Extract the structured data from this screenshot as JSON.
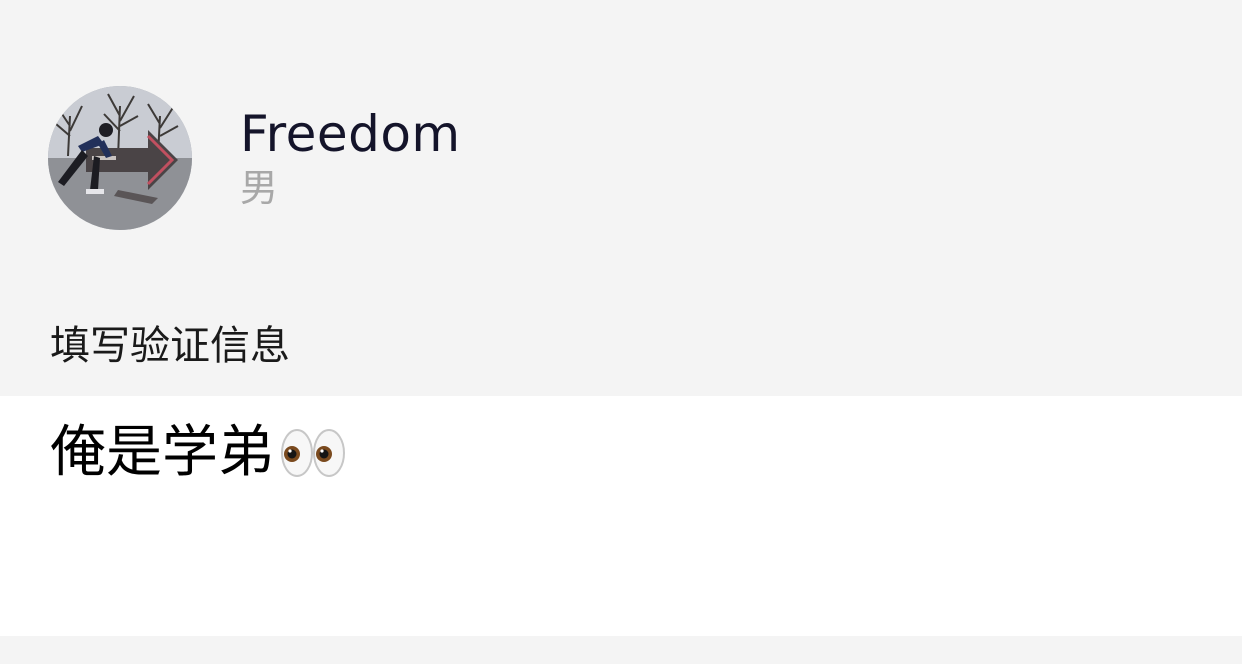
{
  "profile": {
    "name": "Freedom",
    "gender": "男"
  },
  "verification": {
    "label": "填写验证信息",
    "message": "俺是学弟",
    "emoji": "eyes-emoji"
  },
  "colors": {
    "background": "#f4f4f4",
    "input_background": "#ffffff",
    "name_text": "#14142a",
    "gender_text": "#a8a8a8"
  }
}
